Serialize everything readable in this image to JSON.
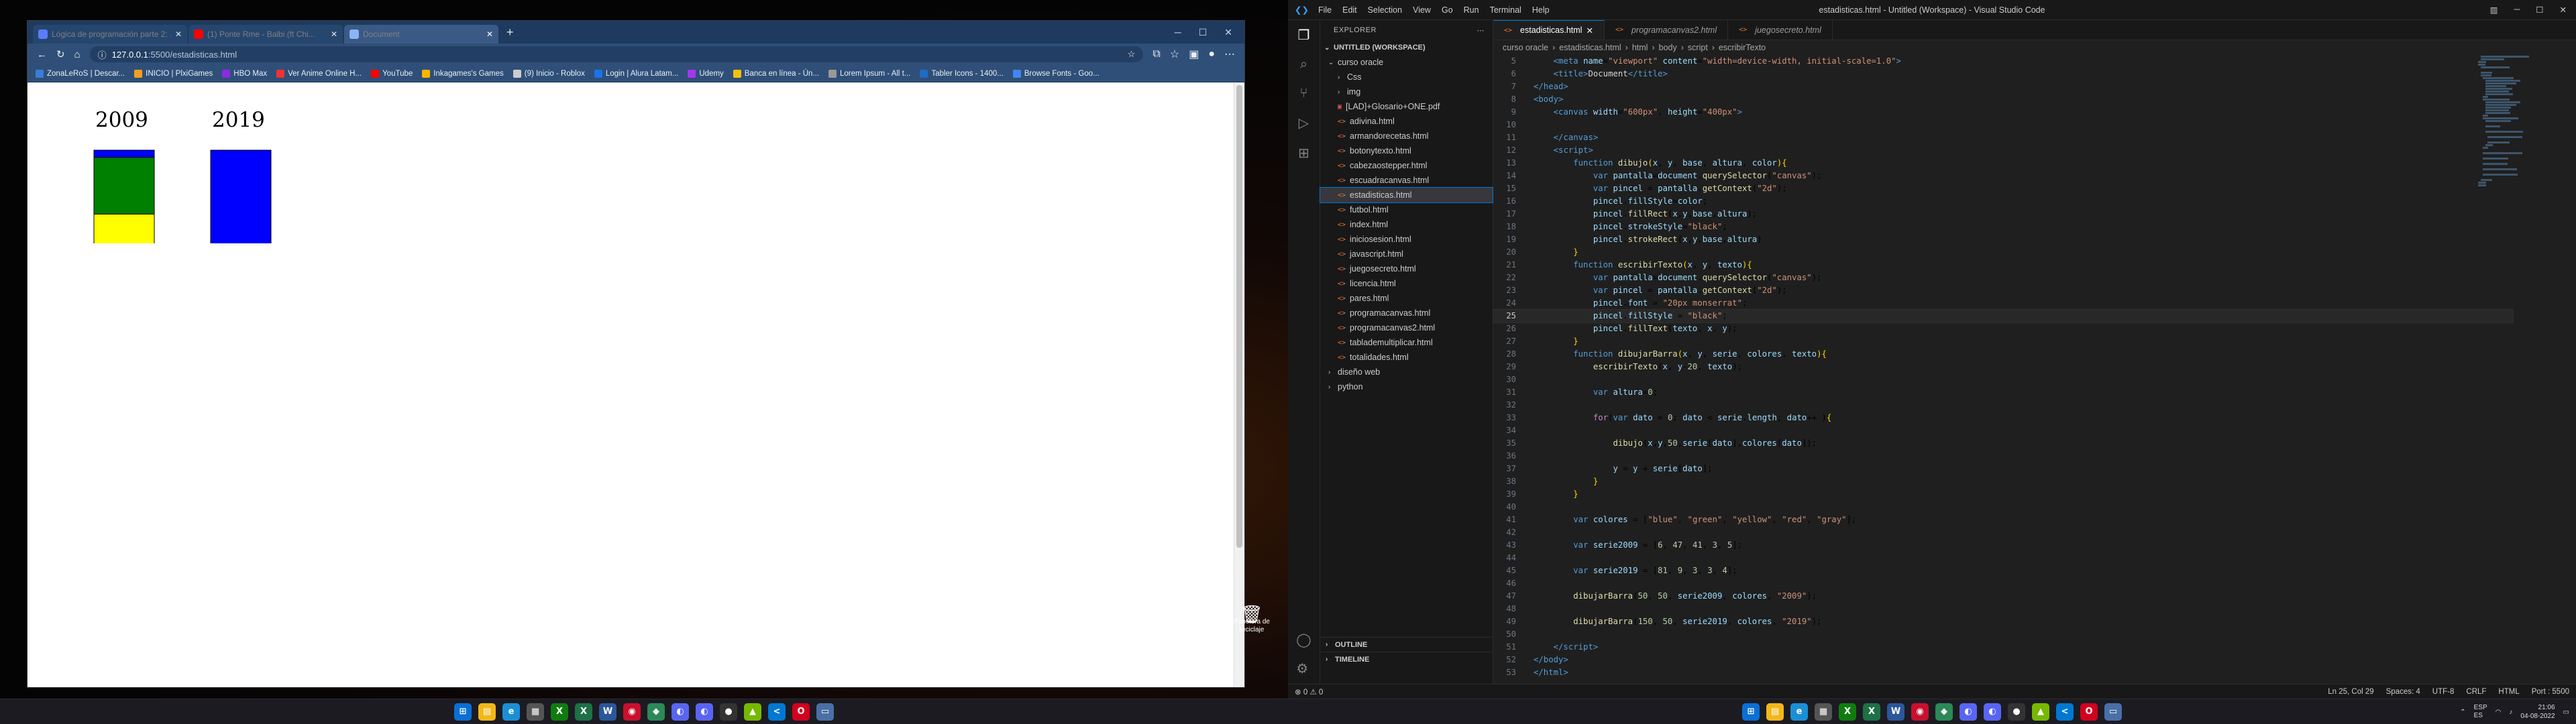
{
  "browser": {
    "tabs": [
      {
        "label": "Lógica de programación parte 2: ...",
        "fav": "#5b7cfa",
        "active": false
      },
      {
        "label": "(1) Ponte Rme - Balbi (ft Chi...",
        "fav": "#ff0000",
        "active": false
      },
      {
        "label": "Document",
        "fav": "#8ab4f8",
        "active": true
      }
    ],
    "newtab_label": "+",
    "url_host": "127.0.0.1",
    "url_rest": ":5500/estadisticas.html",
    "bookmarks": [
      {
        "label": "ZonaLeRoS | Descar...",
        "color": "#3b7dd8"
      },
      {
        "label": "INICIO | PlxiGames",
        "color": "#f0a020"
      },
      {
        "label": "HBO Max",
        "color": "#8a2be2"
      },
      {
        "label": "Ver Anime Online H...",
        "color": "#e33"
      },
      {
        "label": "YouTube",
        "color": "#ff0000"
      },
      {
        "label": "Inkagames's Games",
        "color": "#f7b500"
      },
      {
        "label": "(9) Inicio - Roblox",
        "color": "#ccc"
      },
      {
        "label": "Login | Alura Latam...",
        "color": "#1a73e8"
      },
      {
        "label": "Udemy",
        "color": "#a435f0"
      },
      {
        "label": "Banca en línea - Ún...",
        "color": "#f4c20d"
      },
      {
        "label": "Lorem Ipsum - All t...",
        "color": "#999"
      },
      {
        "label": "Tabler Icons - 1400...",
        "color": "#206bc4"
      },
      {
        "label": "Browse Fonts - Goo...",
        "color": "#4285f4"
      }
    ],
    "page": {
      "year_labels": [
        "2009",
        "2019"
      ],
      "bars": [
        {
          "year": "2009",
          "values": [
            6,
            47,
            41,
            3,
            5
          ]
        },
        {
          "year": "2019",
          "values": [
            81,
            9,
            3,
            3,
            4
          ]
        }
      ],
      "colors": [
        "#0000ff",
        "#008000",
        "#ffff00",
        "#ff0000",
        "#808080"
      ]
    }
  },
  "desktop": {
    "recycle_label": "Papelera de reciclaje"
  },
  "taskbar": {
    "clock_time": "21:06",
    "clock_date": "04-08-2022",
    "lang": "ESP\nES"
  },
  "vscode": {
    "menu": [
      "File",
      "Edit",
      "Selection",
      "View",
      "Go",
      "Run",
      "Terminal",
      "Help"
    ],
    "title": "estadisticas.html - Untitled (Workspace) - Visual Studio Code",
    "explorer_title": "EXPLORER",
    "workspace": "UNTITLED (WORKSPACE)",
    "tree": [
      {
        "label": "curso oracle",
        "indent": 0,
        "type": "folder-open"
      },
      {
        "label": "Css",
        "indent": 1,
        "type": "folder"
      },
      {
        "label": "img",
        "indent": 1,
        "type": "folder"
      },
      {
        "label": "[LAD]+Glosario+ONE.pdf",
        "indent": 1,
        "type": "pdf"
      },
      {
        "label": "adivina.html",
        "indent": 1,
        "type": "html"
      },
      {
        "label": "armandorecetas.html",
        "indent": 1,
        "type": "html"
      },
      {
        "label": "botonytexto.html",
        "indent": 1,
        "type": "html"
      },
      {
        "label": "cabezaostepper.html",
        "indent": 1,
        "type": "html"
      },
      {
        "label": "escuadracanvas.html",
        "indent": 1,
        "type": "html"
      },
      {
        "label": "estadisticas.html",
        "indent": 1,
        "type": "html",
        "selected": true
      },
      {
        "label": "futbol.html",
        "indent": 1,
        "type": "html"
      },
      {
        "label": "index.html",
        "indent": 1,
        "type": "html"
      },
      {
        "label": "iniciosesion.html",
        "indent": 1,
        "type": "html"
      },
      {
        "label": "javascript.html",
        "indent": 1,
        "type": "html"
      },
      {
        "label": "juegosecreto.html",
        "indent": 1,
        "type": "html"
      },
      {
        "label": "licencia.html",
        "indent": 1,
        "type": "html"
      },
      {
        "label": "pares.html",
        "indent": 1,
        "type": "html"
      },
      {
        "label": "programacanvas.html",
        "indent": 1,
        "type": "html"
      },
      {
        "label": "programacanvas2.html",
        "indent": 1,
        "type": "html"
      },
      {
        "label": "tablademultiplicar.html",
        "indent": 1,
        "type": "html"
      },
      {
        "label": "totalidades.html",
        "indent": 1,
        "type": "html"
      },
      {
        "label": "diseño web",
        "indent": 0,
        "type": "folder"
      },
      {
        "label": "python",
        "indent": 0,
        "type": "folder"
      }
    ],
    "outline_label": "OUTLINE",
    "timeline_label": "TIMELINE",
    "editor_tabs": [
      {
        "label": "estadisticas.html",
        "active": true
      },
      {
        "label": "programacanvas2.html",
        "active": false
      },
      {
        "label": "juegosecreto.html",
        "active": false
      }
    ],
    "breadcrumbs": [
      "curso oracle",
      "estadisticas.html",
      "html",
      "body",
      "script",
      "escribirTexto"
    ],
    "first_line": 5,
    "current_line": 25,
    "status_left": "⊗ 0 ⚠ 0",
    "status_right": [
      "Ln 25, Col 29",
      "Spaces: 4",
      "UTF-8",
      "CRLF",
      "HTML",
      "Port : 5500"
    ]
  }
}
